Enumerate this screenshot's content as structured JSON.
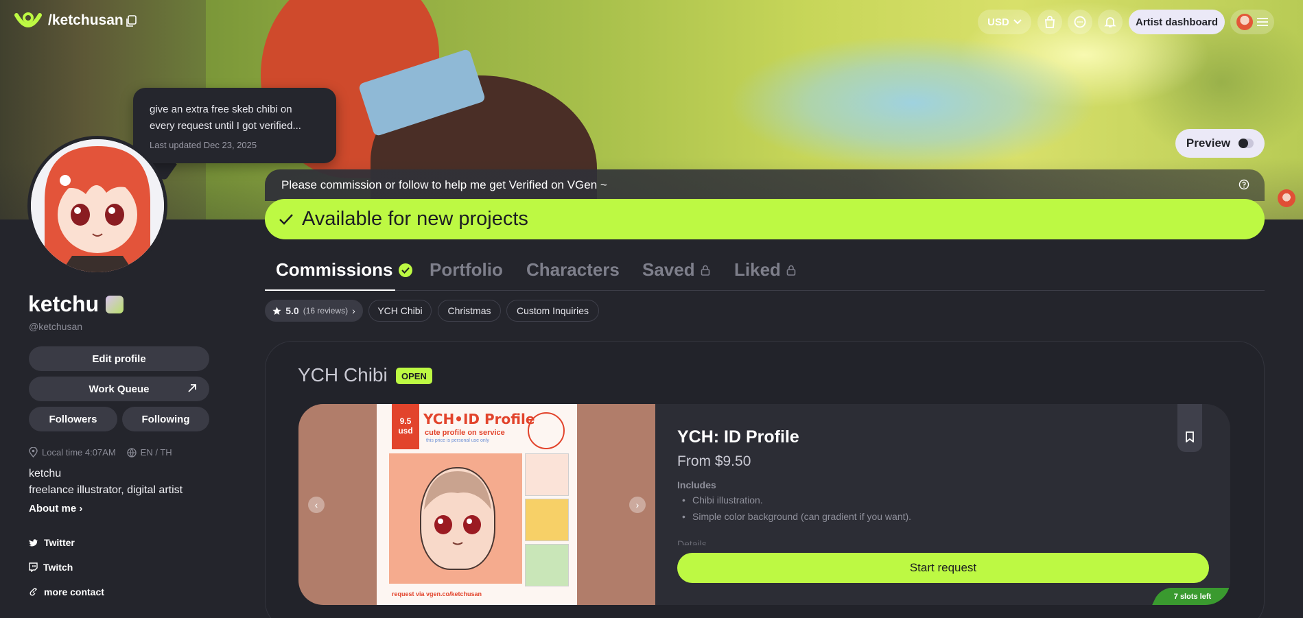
{
  "header": {
    "handle": "/ketchusan",
    "currency": "USD",
    "artist_dashboard": "Artist dashboard",
    "icons": [
      "shopping-bag-icon",
      "chat-icon",
      "bell-icon",
      "menu-icon"
    ]
  },
  "status_bubble": {
    "text": "give an extra free skeb chibi on every request until I got verified...",
    "updated": "Last updated Dec 23, 2025"
  },
  "preview": {
    "label": "Preview",
    "enabled": false
  },
  "announcement": "Please commission or follow to help me get Verified on VGen ~",
  "availability": "Available for new projects",
  "profile": {
    "display_name": "ketchu",
    "handle": "@ketchusan",
    "buttons": {
      "edit_profile": "Edit profile",
      "work_queue": "Work Queue",
      "followers": "Followers",
      "following": "Following"
    },
    "local_time": "Local time 4:07AM",
    "languages": "EN / TH",
    "bio_line1": "ketchu",
    "bio_line2": "freelance illustrator, digital artist",
    "about_me": "About me",
    "links": {
      "twitter": "Twitter",
      "twitch": "Twitch",
      "more_contact": "more contact"
    }
  },
  "tabs": [
    {
      "label": "Commissions",
      "active": true
    },
    {
      "label": "Portfolio",
      "active": false
    },
    {
      "label": "Characters",
      "active": false
    },
    {
      "label": "Saved",
      "active": false,
      "locked": true
    },
    {
      "label": "Liked",
      "active": false,
      "locked": true
    }
  ],
  "filters": {
    "rating": "5.0",
    "reviews": "(16 reviews)",
    "chips": [
      "YCH Chibi",
      "Christmas",
      "Custom Inquiries"
    ]
  },
  "commission_section": {
    "title": "YCH Chibi",
    "status": "OPEN",
    "offer": {
      "name": "YCH: ID Profile",
      "price": "From $9.50",
      "includes_label": "Includes",
      "includes": [
        "Chibi illustration.",
        "Simple color background (can gradient if you want)."
      ],
      "details_label": "Details",
      "start_request": "Start request",
      "slots_left": "7 slots left",
      "art": {
        "price_line1": "9.5",
        "price_line2": "usd",
        "title": "YCH•ID Profile",
        "subtitle": "cute profile on service",
        "note": "this price is personal use only",
        "footer": "request via  vgen.co/ketchusan"
      }
    }
  },
  "colors": {
    "accent": "#bdf943",
    "background": "#24252c",
    "card": "#2c2d35"
  }
}
